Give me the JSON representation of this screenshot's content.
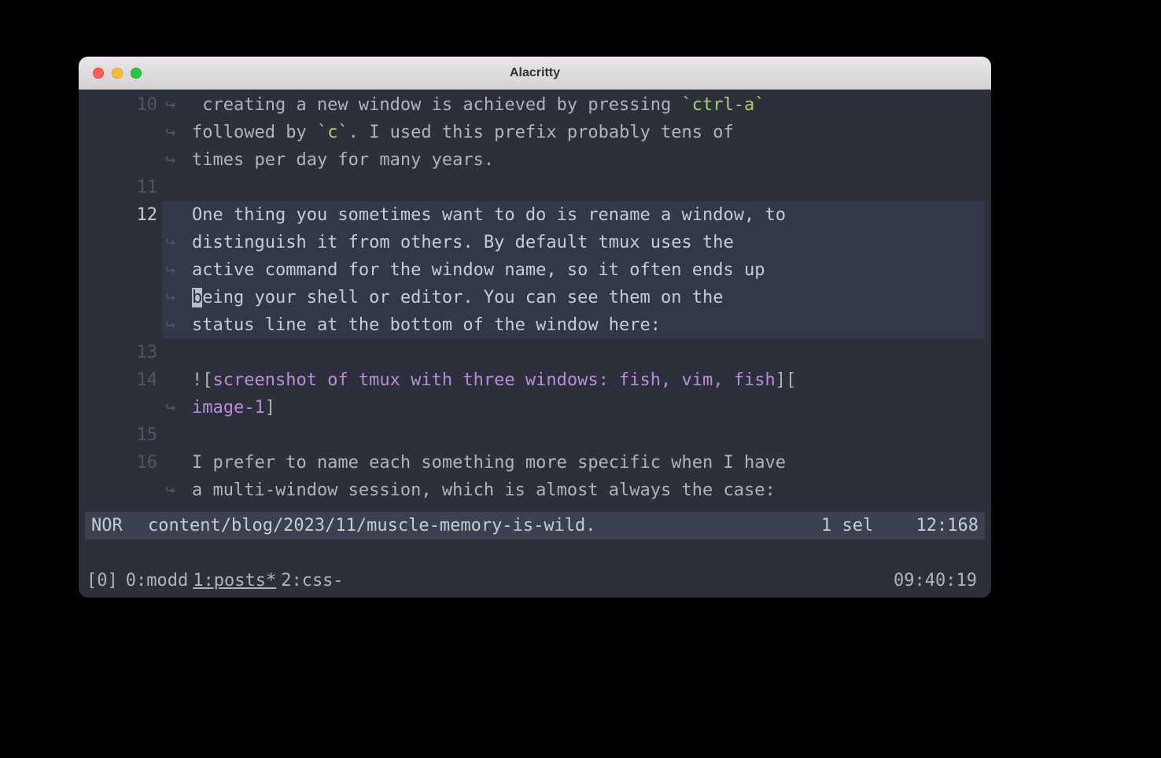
{
  "window": {
    "title": "Alacritty"
  },
  "editor": {
    "lines": [
      {
        "num": "10",
        "wrap": "↪",
        "segments": [
          {
            "t": " creating a new window is achieved by pressing ",
            "c": ""
          },
          {
            "t": "`ctrl-a`",
            "c": "code"
          }
        ]
      },
      {
        "num": "",
        "wrap": "↪",
        "segments": [
          {
            "t": "followed by ",
            "c": ""
          },
          {
            "t": "`c`",
            "c": "code"
          },
          {
            "t": ". I used this prefix probably tens of",
            "c": ""
          }
        ]
      },
      {
        "num": "",
        "wrap": "↪",
        "segments": [
          {
            "t": "times per day for many years.",
            "c": ""
          }
        ]
      },
      {
        "num": "11",
        "wrap": "",
        "segments": [
          {
            "t": "",
            "c": ""
          }
        ]
      },
      {
        "num": "12",
        "wrap": "",
        "hl": true,
        "active": true,
        "segments": [
          {
            "t": "One thing you sometimes want to do is rename a window, to",
            "c": ""
          }
        ]
      },
      {
        "num": "",
        "wrap": "↪",
        "hl": true,
        "segments": [
          {
            "t": "distinguish it from others. By default tmux uses the",
            "c": ""
          }
        ]
      },
      {
        "num": "",
        "wrap": "↪",
        "hl": true,
        "segments": [
          {
            "t": "active command for the window name, so it often ends up",
            "c": ""
          }
        ]
      },
      {
        "num": "",
        "wrap": "↪",
        "hl": true,
        "cursor_at": 0,
        "segments": [
          {
            "t": "being your shell or editor. You can see them on the",
            "c": ""
          }
        ]
      },
      {
        "num": "",
        "wrap": "↪",
        "hl": true,
        "segments": [
          {
            "t": "status line at the bottom of the window here:",
            "c": ""
          }
        ]
      },
      {
        "num": "13",
        "wrap": "",
        "segments": [
          {
            "t": "",
            "c": ""
          }
        ]
      },
      {
        "num": "14",
        "wrap": "",
        "segments": [
          {
            "t": "![",
            "c": "link-bracket"
          },
          {
            "t": "screenshot of tmux with three windows: fish, vim, fish",
            "c": "link-text"
          },
          {
            "t": "][",
            "c": "link-bracket"
          }
        ]
      },
      {
        "num": "",
        "wrap": "↪",
        "segments": [
          {
            "t": "image-1",
            "c": "link-text"
          },
          {
            "t": "]",
            "c": "link-bracket"
          }
        ]
      },
      {
        "num": "15",
        "wrap": "",
        "segments": [
          {
            "t": "",
            "c": ""
          }
        ]
      },
      {
        "num": "16",
        "wrap": "",
        "segments": [
          {
            "t": "I prefer to name each something more specific when I have",
            "c": ""
          }
        ]
      },
      {
        "num": "",
        "wrap": "↪",
        "segments": [
          {
            "t": "a multi-window session, which is almost always the case:",
            "c": ""
          }
        ]
      }
    ]
  },
  "status": {
    "mode": "NOR",
    "file": "content/blog/2023/11/muscle-memory-is-wild.",
    "sel": "1 sel",
    "pos": "12:168"
  },
  "tmux": {
    "session": "[0]",
    "windows": [
      {
        "label": "0:modd",
        "active": false
      },
      {
        "label": "1:posts*",
        "active": true
      },
      {
        "label": "2:css-",
        "active": false
      }
    ],
    "clock": "09:40:19"
  }
}
